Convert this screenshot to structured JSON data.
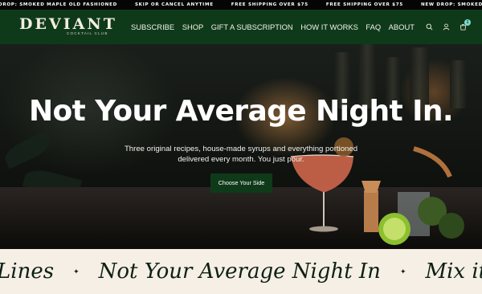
{
  "announcement": {
    "items": [
      "DROP: SMOKED MAPLE OLD FASHIONED",
      "SKIP OR CANCEL ANYTIME",
      "FREE SHIPPING OVER $75",
      "FREE SHIPPING OVER $75",
      "NEW DROP: SMOKED"
    ]
  },
  "header": {
    "logo_word": "DEVIANT",
    "logo_sub": "COCKTAIL CLUB",
    "nav": [
      "SUBSCRIBE",
      "SHOP",
      "GIFT A SUBSCRIPTION",
      "HOW IT WORKS",
      "FAQ",
      "ABOUT"
    ],
    "icons": [
      "search-icon",
      "account-icon",
      "cart-icon"
    ],
    "cart_count": "1",
    "colors": {
      "header_bg": "#0f3a1a",
      "badge": "#7fd8cf"
    }
  },
  "hero": {
    "title": "Not Your Average Night In.",
    "subtitle": "Three original recipes, house-made syrups and everything portioned delivered every month. You just pour.",
    "cta": "Choose Your Side"
  },
  "marquee": {
    "items": [
      "Lines",
      "Not Your Average Night In",
      "Mix it. Sip"
    ],
    "separator": "✦"
  }
}
